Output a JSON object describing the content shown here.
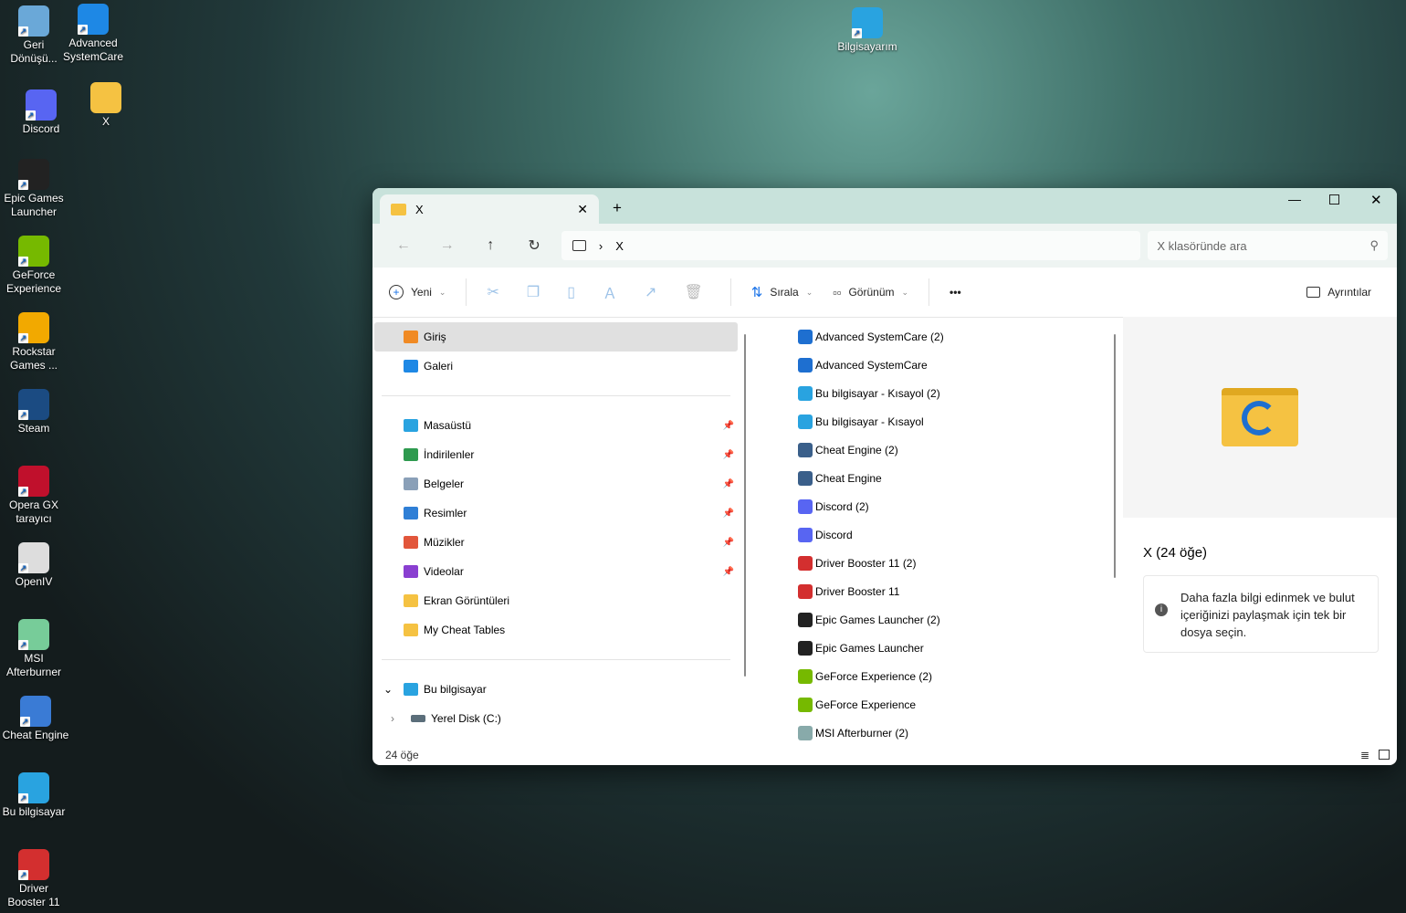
{
  "desktop": {
    "icons": [
      {
        "label": "Geri Dönüşü...",
        "icon": "recycle-bin-icon",
        "color": "#6aa8d8"
      },
      {
        "label": "Advanced SystemCare",
        "icon": "advanced-systemcare-icon",
        "color": "#1e88e5"
      },
      {
        "label": "Discord",
        "icon": "discord-icon",
        "color": "#5865f2"
      },
      {
        "label": "X",
        "icon": "folder-icon",
        "color": "#f5c242"
      },
      {
        "label": "Epic Games Launcher",
        "icon": "epic-games-icon",
        "color": "#222"
      },
      {
        "label": "GeForce Experience",
        "icon": "geforce-icon",
        "color": "#76b900"
      },
      {
        "label": "Rockstar Games ...",
        "icon": "rockstar-icon",
        "color": "#f2a900"
      },
      {
        "label": "Steam",
        "icon": "steam-icon",
        "color": "#1b4b82"
      },
      {
        "label": "Opera GX tarayıcı",
        "icon": "opera-gx-icon",
        "color": "#c0102c"
      },
      {
        "label": "OpenIV",
        "icon": "openiv-icon",
        "color": "#ddd"
      },
      {
        "label": "MSI Afterburner",
        "icon": "msi-afterburner-icon",
        "color": "#7c9"
      },
      {
        "label": "Cheat Engine",
        "icon": "cheat-engine-icon",
        "color": "#3a7bd5"
      },
      {
        "label": "Bu bilgisayar",
        "icon": "computer-icon",
        "color": "#29a3e0"
      },
      {
        "label": "Driver Booster 11",
        "icon": "driver-booster-icon",
        "color": "#d32f2f"
      },
      {
        "label": "Bilgisayarım",
        "icon": "computer-icon",
        "color": "#29a3e0"
      }
    ]
  },
  "explorer": {
    "tab_title": "X",
    "breadcrumb": [
      "X"
    ],
    "search_placeholder": "X klasöründe ara",
    "toolbar": {
      "new": "Yeni",
      "sort": "Sırala",
      "view": "Görünüm",
      "more": "•••",
      "details": "Ayrıntılar"
    },
    "nav": {
      "top": [
        {
          "label": "Giriş",
          "color": "#f08a24"
        },
        {
          "label": "Galeri",
          "color": "#1e88e5"
        }
      ],
      "pinned": [
        {
          "label": "Masaüstü",
          "color": "#29a3e0"
        },
        {
          "label": "İndirilenler",
          "color": "#2e9a4f"
        },
        {
          "label": "Belgeler",
          "color": "#8aa0b8"
        },
        {
          "label": "Resimler",
          "color": "#2f7fd6"
        },
        {
          "label": "Müzikler",
          "color": "#e2563b"
        },
        {
          "label": "Videolar",
          "color": "#8a3fd1"
        }
      ],
      "folders": [
        "Ekran Görüntüleri",
        "My Cheat Tables"
      ],
      "this_pc": "Bu bilgisayar",
      "drive": "Yerel Disk (C:)"
    },
    "files": [
      {
        "name": "Advanced SystemCare (2)",
        "color": "#1e6fd0"
      },
      {
        "name": "Advanced SystemCare",
        "color": "#1e6fd0"
      },
      {
        "name": "Bu bilgisayar - Kısayol (2)",
        "color": "#29a3e0"
      },
      {
        "name": "Bu bilgisayar - Kısayol",
        "color": "#29a3e0"
      },
      {
        "name": "Cheat Engine (2)",
        "color": "#3a5f8a"
      },
      {
        "name": "Cheat Engine",
        "color": "#3a5f8a"
      },
      {
        "name": "Discord (2)",
        "color": "#5865f2"
      },
      {
        "name": "Discord",
        "color": "#5865f2"
      },
      {
        "name": "Driver Booster 11 (2)",
        "color": "#d32f2f"
      },
      {
        "name": "Driver Booster 11",
        "color": "#d32f2f"
      },
      {
        "name": "Epic Games Launcher (2)",
        "color": "#222"
      },
      {
        "name": "Epic Games Launcher",
        "color": "#222"
      },
      {
        "name": "GeForce Experience (2)",
        "color": "#76b900"
      },
      {
        "name": "GeForce Experience",
        "color": "#76b900"
      },
      {
        "name": "MSI Afterburner (2)",
        "color": "#8aa"
      }
    ],
    "details": {
      "title": "X (24 öğe)",
      "info": "Daha fazla bilgi edinmek ve bulut içeriğinizi paylaşmak için tek bir dosya seçin."
    },
    "status": "24 öğe"
  }
}
